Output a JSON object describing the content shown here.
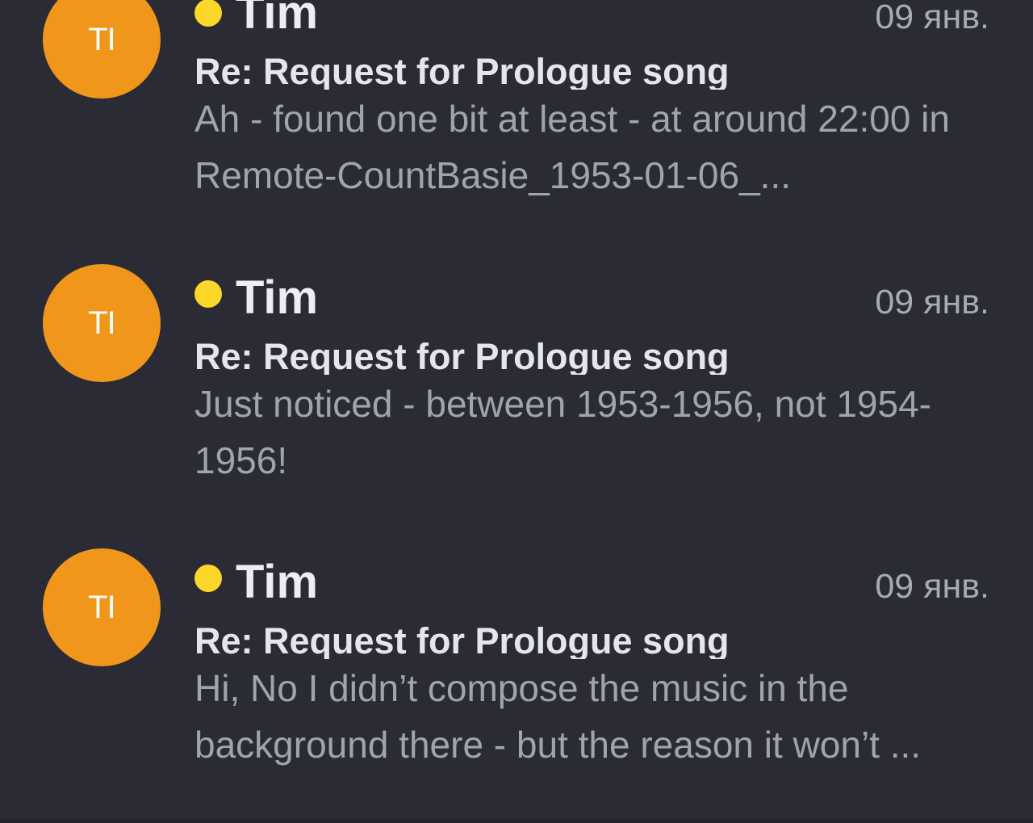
{
  "colors": {
    "background": "#2a2b35",
    "avatar": "#f0961a",
    "unread_dot": "#fcd628"
  },
  "messages": [
    {
      "avatar_initials": "TI",
      "unread": true,
      "sender": "Tim",
      "date": "09 янв.",
      "subject": "Re: Request for Prologue song",
      "snippet": "Ah - found one bit at least - at around 22:00 in Remote-CountBasie_1953-01-06_..."
    },
    {
      "avatar_initials": "TI",
      "unread": true,
      "sender": "Tim",
      "date": "09 янв.",
      "subject": "Re: Request for Prologue song",
      "snippet": "Just noticed - between 1953-1956, not 1954-1956!"
    },
    {
      "avatar_initials": "TI",
      "unread": true,
      "sender": "Tim",
      "date": "09 янв.",
      "subject": "Re: Request for Prologue song",
      "snippet": "Hi, No I didn’t compose the music in the background there - but the reason it won’t ..."
    }
  ]
}
